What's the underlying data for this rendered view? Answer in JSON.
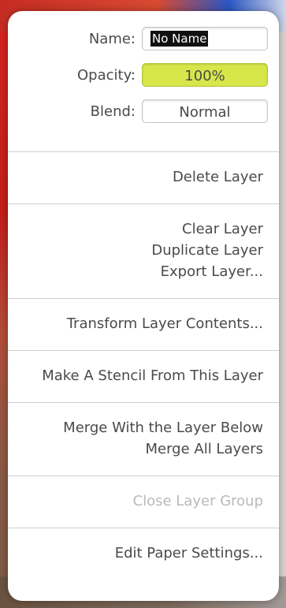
{
  "layer_panel": {
    "name_label": "Name:",
    "name_value": "No Name",
    "opacity_label": "Opacity:",
    "opacity_value": "100%",
    "blend_label": "Blend:",
    "blend_value": "Normal"
  },
  "menu": {
    "delete_layer": "Delete Layer",
    "clear_layer": "Clear Layer",
    "duplicate_layer": "Duplicate Layer",
    "export_layer": "Export Layer...",
    "transform_layer_contents": "Transform Layer Contents...",
    "make_stencil": "Make A Stencil From This Layer",
    "merge_with_below": "Merge With the Layer Below",
    "merge_all_layers": "Merge All Layers",
    "close_layer_group": "Close Layer Group",
    "edit_paper_settings": "Edit Paper Settings..."
  },
  "colors": {
    "opacity_field": "#d7e74a",
    "disabled_text": "#b9b9b9"
  }
}
